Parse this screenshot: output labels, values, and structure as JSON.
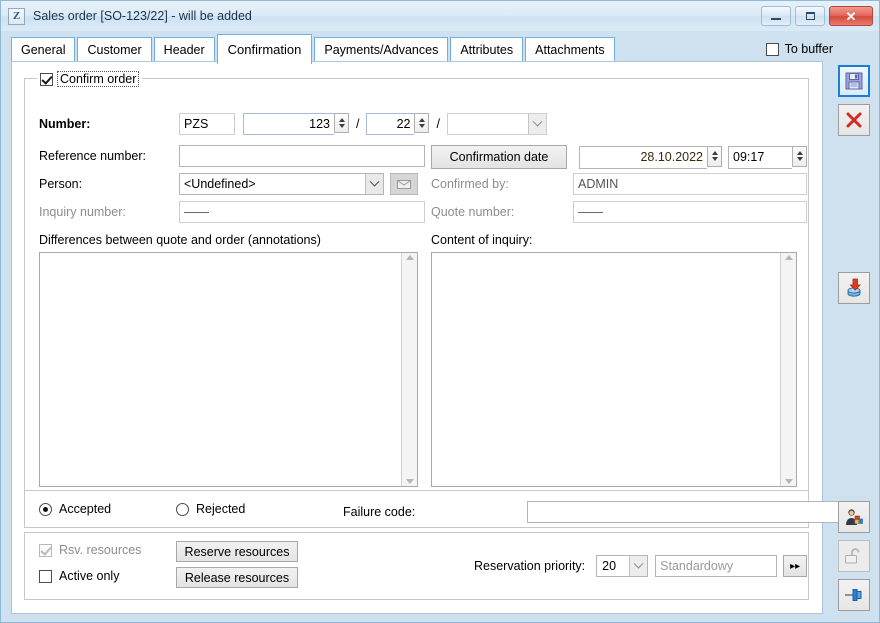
{
  "window": {
    "title": "Sales order [SO-123/22] - will be added",
    "app_icon": "Z",
    "minimize_label": "minimize",
    "maximize_label": "maximize",
    "close_label": "✕"
  },
  "tabs": [
    {
      "label": "General",
      "active": false
    },
    {
      "label": "Customer",
      "active": false
    },
    {
      "label": "Header",
      "active": false
    },
    {
      "label": "Confirmation",
      "active": true
    },
    {
      "label": "Payments/Advances",
      "active": false
    },
    {
      "label": "Attributes",
      "active": false
    },
    {
      "label": "Attachments",
      "active": false
    }
  ],
  "to_buffer": {
    "label": "To buffer",
    "checked": false
  },
  "group": {
    "legend": "Confirm order",
    "legend_checked": true
  },
  "number_row": {
    "label": "Number:",
    "prefix": "PZS",
    "serial": "123",
    "year": "22",
    "extra": "",
    "sep": "/"
  },
  "reference": {
    "label": "Reference number:",
    "value": ""
  },
  "person": {
    "label": "Person:",
    "value": "<Undefined>",
    "mail_icon": "envelope-icon"
  },
  "inquiry": {
    "label": "Inquiry number:",
    "value": "——"
  },
  "confirmation_date": {
    "button_label": "Confirmation date",
    "date": "28.10.2022",
    "time": "09:17"
  },
  "confirmed_by": {
    "label": "Confirmed by:",
    "value": "ADMIN"
  },
  "quote_number": {
    "label": "Quote number:",
    "value": "——"
  },
  "differences": {
    "label": "Differences between quote and order (annotations)",
    "value": ""
  },
  "content_of_inquiry": {
    "label": "Content of inquiry:",
    "value": ""
  },
  "status": {
    "accepted_label": "Accepted",
    "rejected_label": "Rejected",
    "accepted_checked": true,
    "rejected_checked": false,
    "failure_code_label": "Failure code:",
    "failure_code_value": ""
  },
  "resources": {
    "rsv_label": "Rsv. resources",
    "rsv_checked": true,
    "rsv_disabled": true,
    "active_only_label": "Active only",
    "active_only_checked": false,
    "reserve_button": "Reserve resources",
    "release_button": "Release resources",
    "priority_label": "Reservation priority:",
    "priority_value": "20",
    "priority_name": "Standardowy",
    "more_button": "▸▸"
  },
  "toolbar": [
    {
      "name": "save-icon",
      "glyph": "save",
      "state": "selected"
    },
    {
      "name": "cancel-icon",
      "glyph": "cross",
      "state": "normal"
    },
    {
      "name": "import-icon",
      "glyph": "import",
      "state": "normal"
    },
    {
      "name": "permissions-icon",
      "glyph": "person",
      "state": "normal"
    },
    {
      "name": "unlock-icon",
      "glyph": "lock",
      "state": "disabled"
    },
    {
      "name": "pin-icon",
      "glyph": "pin",
      "state": "normal"
    }
  ],
  "colors": {
    "accent": "#1a7fd4",
    "tab_border": "#6cb2e4",
    "window_bg": "#cfe0ef",
    "close_red": "#d44a3c"
  }
}
